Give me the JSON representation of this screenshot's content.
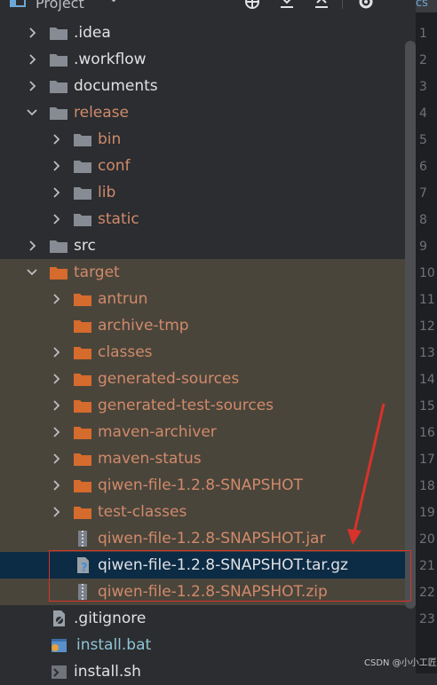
{
  "panel": {
    "title": "Project",
    "toolbar_icons": [
      "locate-icon",
      "expand-all-icon",
      "collapse-all-icon",
      "settings-icon"
    ]
  },
  "tree": [
    {
      "label": ".idea",
      "depth": 0,
      "kind": "folder",
      "expandable": true,
      "expanded": false,
      "color": "normal"
    },
    {
      "label": ".workflow",
      "depth": 0,
      "kind": "folder",
      "expandable": true,
      "expanded": false,
      "color": "normal"
    },
    {
      "label": "documents",
      "depth": 0,
      "kind": "folder",
      "expandable": true,
      "expanded": false,
      "color": "normal"
    },
    {
      "label": "release",
      "depth": 0,
      "kind": "folder",
      "expandable": true,
      "expanded": true,
      "color": "excluded"
    },
    {
      "label": "bin",
      "depth": 1,
      "kind": "folder",
      "expandable": true,
      "expanded": false,
      "color": "excluded"
    },
    {
      "label": "conf",
      "depth": 1,
      "kind": "folder",
      "expandable": true,
      "expanded": false,
      "color": "excluded"
    },
    {
      "label": "lib",
      "depth": 1,
      "kind": "folder",
      "expandable": true,
      "expanded": false,
      "color": "excluded"
    },
    {
      "label": "static",
      "depth": 1,
      "kind": "folder",
      "expandable": true,
      "expanded": false,
      "color": "excluded"
    },
    {
      "label": "src",
      "depth": 0,
      "kind": "folder",
      "expandable": true,
      "expanded": false,
      "color": "normal"
    },
    {
      "label": "target",
      "depth": 0,
      "kind": "folder-orange",
      "expandable": true,
      "expanded": true,
      "color": "excluded",
      "bg": "target"
    },
    {
      "label": "antrun",
      "depth": 1,
      "kind": "folder-orange",
      "expandable": true,
      "expanded": false,
      "color": "excluded",
      "bg": "target"
    },
    {
      "label": "archive-tmp",
      "depth": 1,
      "kind": "folder-orange",
      "expandable": false,
      "expanded": false,
      "color": "excluded",
      "bg": "target"
    },
    {
      "label": "classes",
      "depth": 1,
      "kind": "folder-orange",
      "expandable": true,
      "expanded": false,
      "color": "excluded",
      "bg": "target"
    },
    {
      "label": "generated-sources",
      "depth": 1,
      "kind": "folder-orange",
      "expandable": true,
      "expanded": false,
      "color": "excluded",
      "bg": "target"
    },
    {
      "label": "generated-test-sources",
      "depth": 1,
      "kind": "folder-orange",
      "expandable": true,
      "expanded": false,
      "color": "excluded",
      "bg": "target"
    },
    {
      "label": "maven-archiver",
      "depth": 1,
      "kind": "folder-orange",
      "expandable": true,
      "expanded": false,
      "color": "excluded",
      "bg": "target"
    },
    {
      "label": "maven-status",
      "depth": 1,
      "kind": "folder-orange",
      "expandable": true,
      "expanded": false,
      "color": "excluded",
      "bg": "target"
    },
    {
      "label": "qiwen-file-1.2.8-SNAPSHOT",
      "depth": 1,
      "kind": "folder-orange",
      "expandable": true,
      "expanded": false,
      "color": "excluded",
      "bg": "target"
    },
    {
      "label": "test-classes",
      "depth": 1,
      "kind": "folder-orange",
      "expandable": true,
      "expanded": false,
      "color": "excluded",
      "bg": "target"
    },
    {
      "label": "qiwen-file-1.2.8-SNAPSHOT.jar",
      "depth": 1,
      "kind": "archive",
      "expandable": false,
      "expanded": false,
      "color": "excluded",
      "bg": "target"
    },
    {
      "label": "qiwen-file-1.2.8-SNAPSHOT.tar.gz",
      "depth": 1,
      "kind": "unknown-file",
      "expandable": false,
      "expanded": false,
      "color": "normal",
      "bg": "selected"
    },
    {
      "label": "qiwen-file-1.2.8-SNAPSHOT.zip",
      "depth": 1,
      "kind": "archive",
      "expandable": false,
      "expanded": false,
      "color": "excluded",
      "bg": "target"
    },
    {
      "label": ".gitignore",
      "depth": 0,
      "kind": "gitignore-file",
      "expandable": false,
      "expanded": false,
      "color": "normal"
    },
    {
      "label": "install.bat",
      "depth": 0,
      "kind": "bat-file",
      "expandable": false,
      "expanded": false,
      "color": "bat"
    },
    {
      "label": "install.sh",
      "depth": 0,
      "kind": "sh-file",
      "expandable": false,
      "expanded": false,
      "color": "normal"
    }
  ],
  "editor_gutter": {
    "tab_label": "cs",
    "line_numbers": [
      "1",
      "2",
      "3",
      "4",
      "5",
      "6",
      "7",
      "8",
      "9",
      "10",
      "11",
      "12",
      "13",
      "14",
      "15",
      "16",
      "17",
      "18",
      "19",
      "20",
      "21",
      "22",
      "23"
    ]
  },
  "watermark": "CSDN @小小工匠",
  "colors": {
    "background": "#2b2d30",
    "excluded_text": "#d08a6a",
    "target_bg": "#4a453b",
    "selected_bg": "#0c2b44",
    "annotation_red": "#d9322a"
  }
}
